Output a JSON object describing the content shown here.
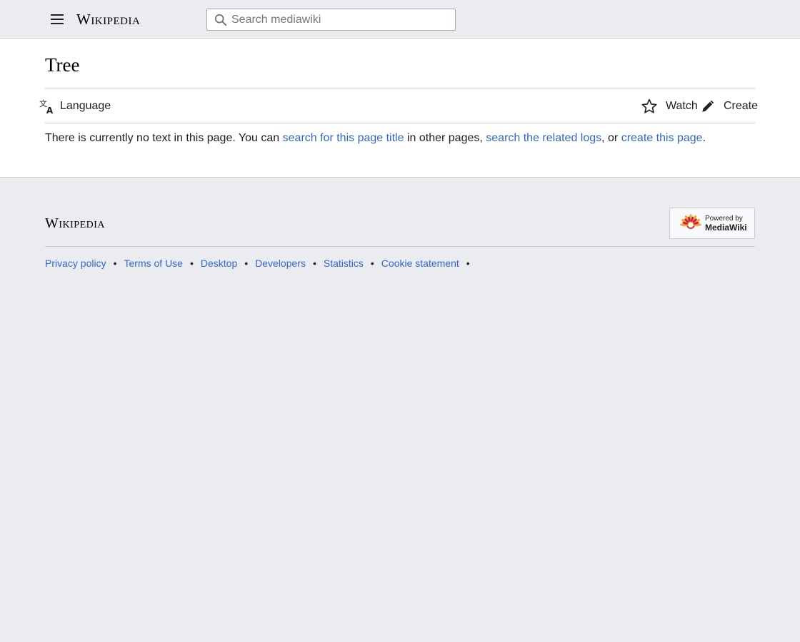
{
  "header": {
    "wordmark": "Wikipedia",
    "search": {
      "placeholder": "Search mediawiki",
      "value": ""
    }
  },
  "page": {
    "title": "Tree",
    "toolbar": {
      "language_label": "Language",
      "watch_label": "Watch",
      "create_label": "Create"
    },
    "notice": {
      "text_1": "There is currently no text in this page. You can ",
      "link_search_title": "search for this page title",
      "text_2": " in other pages, ",
      "link_related_logs": "search the related logs",
      "text_3": ", or ",
      "link_create_page": "create this page",
      "text_4": "."
    }
  },
  "footer": {
    "wordmark": "Wikipedia",
    "powered_small": "Powered by",
    "powered_big": "MediaWiki",
    "links": [
      {
        "label": "Privacy policy"
      },
      {
        "label": "Terms of Use"
      },
      {
        "label": "Desktop"
      },
      {
        "label": "Developers"
      },
      {
        "label": "Statistics"
      },
      {
        "label": "Cookie statement"
      }
    ]
  },
  "colors": {
    "link": "#3366cc",
    "text": "#202122",
    "chrome_bg": "#eaecf0",
    "content_bg": "#ffffff",
    "border": "#c8ccd1"
  }
}
